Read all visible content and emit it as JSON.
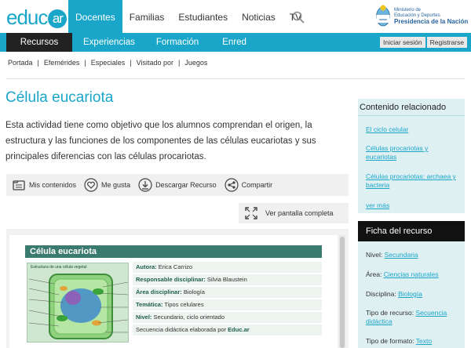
{
  "header": {
    "logo_text": "educ",
    "logo_ar": "ar",
    "nav": [
      {
        "label": "Docentes",
        "active": true
      },
      {
        "label": "Familias",
        "active": false
      },
      {
        "label": "Estudiantes",
        "active": false
      },
      {
        "label": "Noticias",
        "active": false
      },
      {
        "label": "TV",
        "active": false
      }
    ],
    "gov_line1": "Ministerio de",
    "gov_line2": "Educación y Deportes",
    "gov_line3": "Presidencia de la Nación"
  },
  "subnav": {
    "items": [
      "Recursos",
      "Experiencias",
      "Formación",
      "Enred"
    ],
    "login": "Iniciar sesión",
    "register": "Registrarse"
  },
  "breadcrumbs": [
    "Portada",
    "Efemérides",
    "Especiales",
    "Visitado por",
    "Juegos"
  ],
  "main": {
    "title": "Célula eucariota",
    "description": "Esta actividad tiene como objetivo que los alumnos comprendan el origen, la estructura y las funciones de los componentes de las células eucariotas y sus principales diferencias con las células procariotas.",
    "actions": {
      "my_contents": "Mis contenidos",
      "like": "Me gusta",
      "download": "Descargar Recurso",
      "share": "Compartir"
    },
    "fullscreen": "Ver pantalla completa"
  },
  "document": {
    "title": "Célula eucariota",
    "image_caption": "Estructura de una célula vegetal",
    "rows": [
      {
        "key": "Autora:",
        "value": "Erica Carrizo"
      },
      {
        "key": "Responsable disciplinar:",
        "value": "Silvia Blaustein"
      },
      {
        "key": "Área disciplinar:",
        "value": "Biología"
      },
      {
        "key": "Temática:",
        "value": "Tipos celulares"
      },
      {
        "key": "Nivel:",
        "value": "Secundario, ciclo orientado"
      },
      {
        "key": "Secuencia didáctica elaborada por",
        "value": "Educ.ar"
      }
    ]
  },
  "sidebar": {
    "related_title": "Contenido relacionado",
    "related_links": [
      "El ciclo celular",
      "Células procariotas y eucariotas",
      "Células procariotas: archaea y bacteria",
      "ver más"
    ],
    "ficha_title": "Ficha del recurso",
    "ficha": [
      {
        "key": "Nivel:",
        "value": "Secundaria"
      },
      {
        "key": "Área:",
        "value": "Ciencias naturales"
      },
      {
        "key": "Disciplina:",
        "value": "Biología"
      },
      {
        "key": "Tipo de recurso:",
        "value": "Secuencia didáctica"
      },
      {
        "key": "Tipo de formato:",
        "value": "Texto"
      }
    ]
  },
  "colors": {
    "brand": "#1aa6c9",
    "dark": "#222222",
    "doc_header": "#3b7a6f"
  }
}
